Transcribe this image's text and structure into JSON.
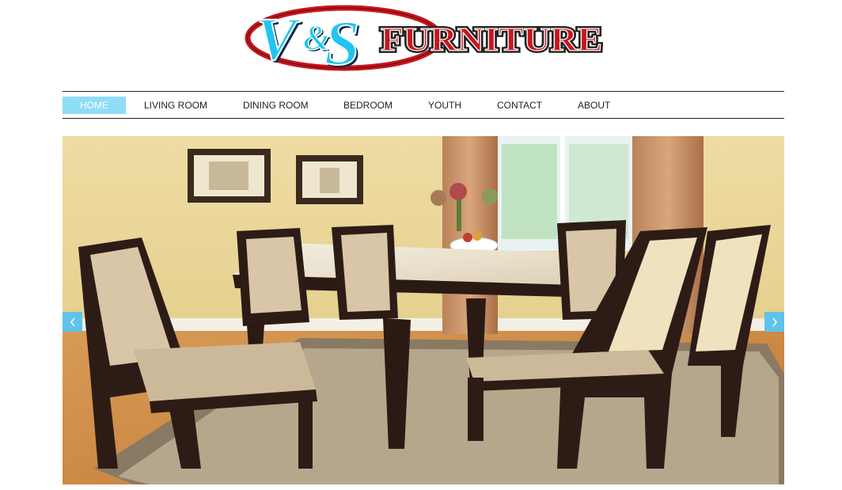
{
  "logo": {
    "text_mark": "V&S",
    "text_word": "FURNITURE",
    "colors": {
      "blue": "#1ec6ef",
      "red": "#c8161d",
      "dark": "#0a2a4a"
    }
  },
  "nav": {
    "items": [
      {
        "label": "HOME",
        "active": true
      },
      {
        "label": "LIVING ROOM",
        "active": false
      },
      {
        "label": "DINING ROOM",
        "active": false
      },
      {
        "label": "BEDROOM",
        "active": false
      },
      {
        "label": "YOUTH",
        "active": false
      },
      {
        "label": "CONTACT",
        "active": false
      },
      {
        "label": "ABOUT",
        "active": false
      }
    ],
    "active_color": "#8fdcf7"
  },
  "slider": {
    "image_subject": "dining room set with marble-top table and six upholstered chairs",
    "prev_icon": "chevron-left-icon",
    "next_icon": "chevron-right-icon",
    "arrow_color": "#5fc3ea"
  }
}
